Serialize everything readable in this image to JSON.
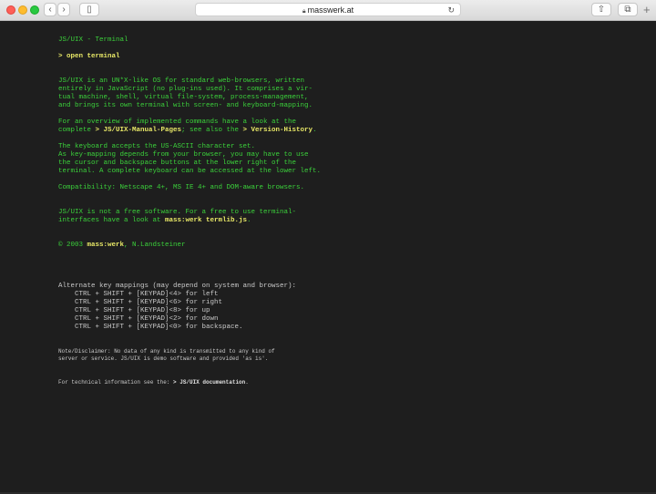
{
  "browser": {
    "url_host": "masswerk.at"
  },
  "terminal": {
    "title": "JS/UIX - Terminal",
    "command_prompt": "> ",
    "command": "open terminal",
    "intro": [
      "JS/UIX is an UN*X-like OS for standard web-browsers, written",
      "entirely in JavaScript (no plug-ins used). It comprises a vir-",
      "tual machine, shell, virtual file-system, process-management,",
      "and brings its own terminal with screen- and keyboard-mapping."
    ],
    "overview_1": "For an overview of implemented commands have a look at the",
    "overview_2_pre": "complete ",
    "overview_link_manual": "> JS/UIX-Manual-Pages",
    "overview_2_mid": "; see also the ",
    "overview_link_version": "> Version-History",
    "overview_2_end": ".",
    "keyboard": [
      "The keyboard accepts the US-ASCII character set.",
      "As key-mapping depends from your browser, you may have to use",
      "the cursor and backspace buttons at the lower right of the",
      "terminal. A complete keyboard can be accessed at the lower left."
    ],
    "compatibility": "Compatibility: Netscape 4+, MS IE 4+ and DOM-aware browsers.",
    "free_1": "JS/UIX is not a free software. For a free to use terminal-",
    "free_2_pre": "interfaces have a look at ",
    "free_link": "mass:werk termlib.js",
    "free_2_end": ".",
    "copyright_pre": "© 2003 ",
    "copyright_brand": "mass:werk",
    "copyright_post": ", N.Landsteiner",
    "alt_title": "Alternate key mappings (may depend on system and browser):",
    "alt_mappings": [
      "CTRL + SHIFT + [KEYPAD]<4> for left",
      "CTRL + SHIFT + [KEYPAD]<6> for right",
      "CTRL + SHIFT + [KEYPAD]<8> for up",
      "CTRL + SHIFT + [KEYPAD]<2> for down",
      "CTRL + SHIFT + [KEYPAD]<0> for backspace."
    ],
    "disclaimer_1": "Note/Disclaimer: No data of any kind is transmitted to any kind of",
    "disclaimer_2": "server or service. JS/UIX is demo software and provided 'as is'.",
    "tech_pre": "For technical information see the: ",
    "tech_link": "> JS/UIX documentation",
    "tech_end": "."
  }
}
